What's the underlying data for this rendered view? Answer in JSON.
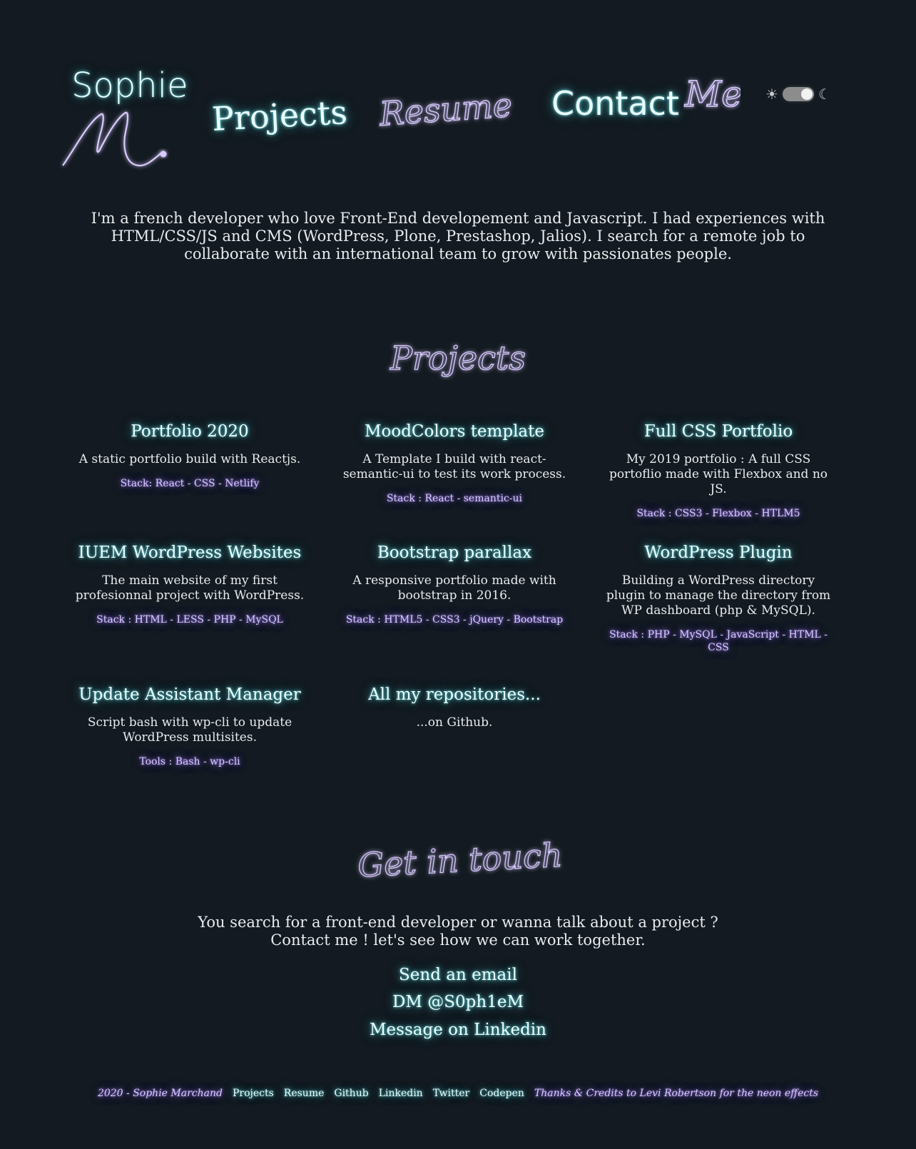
{
  "header": {
    "logo_first": "Sophie",
    "logo_initial": "M.",
    "nav": {
      "projects": "Projects",
      "resume": "Resume",
      "contact": "Contact",
      "me": "Me"
    },
    "theme_toggle": {
      "sun_icon": "sun-icon",
      "moon_icon": "moon-icon",
      "state": "dark"
    }
  },
  "intro": "I'm a french developer who love Front-End developement and Javascript. I had experiences with HTML/CSS/JS and CMS (WordPress, Plone, Prestashop, Jalios). I search for a remote job to collaborate with an international team to grow with passionates people.",
  "projects_section": {
    "title": "Projects",
    "items": [
      {
        "title": "Portfolio 2020",
        "description": "A static portfolio build with Reactjs.",
        "stack": "Stack: React - CSS - Netlify"
      },
      {
        "title": "MoodColors template",
        "description": "A Template I build with react-semantic-ui to test its work process.",
        "stack": "Stack : React - semantic-ui"
      },
      {
        "title": "Full CSS Portfolio",
        "description": "My 2019 portfolio : A full CSS portoflio made with Flexbox and no JS.",
        "stack": "Stack : CSS3 - Flexbox - HTLM5"
      },
      {
        "title": "IUEM WordPress Websites",
        "description": "The main website of my first profesionnal project with WordPress.",
        "stack": "Stack : HTML - LESS - PHP - MySQL"
      },
      {
        "title": "Bootstrap parallax",
        "description": "A responsive portfolio made with bootstrap in 2016.",
        "stack": "Stack : HTML5 - CSS3 - jQuery - Bootstrap"
      },
      {
        "title": "WordPress Plugin",
        "description": "Building a WordPress directory plugin to manage the directory from WP dashboard (php & MySQL).",
        "stack": "Stack : PHP - MySQL - JavaScript - HTML - CSS"
      },
      {
        "title": "Update Assistant Manager",
        "description": "Script bash with wp-cli to update WordPress multisites.",
        "stack": "Tools : Bash - wp-cli"
      },
      {
        "title": "All my repositories...",
        "description": "...on Github.",
        "stack": ""
      }
    ]
  },
  "contact_section": {
    "title": "Get in touch",
    "line1": "You search for a front-end developer or wanna talk about a project ?",
    "line2": "Contact me ! let's see how we can work together.",
    "links": {
      "email": "Send an email",
      "dm": "DM @S0ph1eM",
      "linkedin": "Message on Linkedin"
    }
  },
  "footer": {
    "copyright": "2020 - Sophie Marchand",
    "links": {
      "projects": "Projects",
      "resume": "Resume",
      "github": "Github",
      "linkedin": "Linkedin",
      "twitter": "Twitter",
      "codepen": "Codepen"
    },
    "credits": "Thanks & Credits to Levi Robertson for the neon effects"
  },
  "colors": {
    "background": "#131a21",
    "neon_cyan": "#6fe3e6",
    "neon_purple": "#a783ff"
  }
}
